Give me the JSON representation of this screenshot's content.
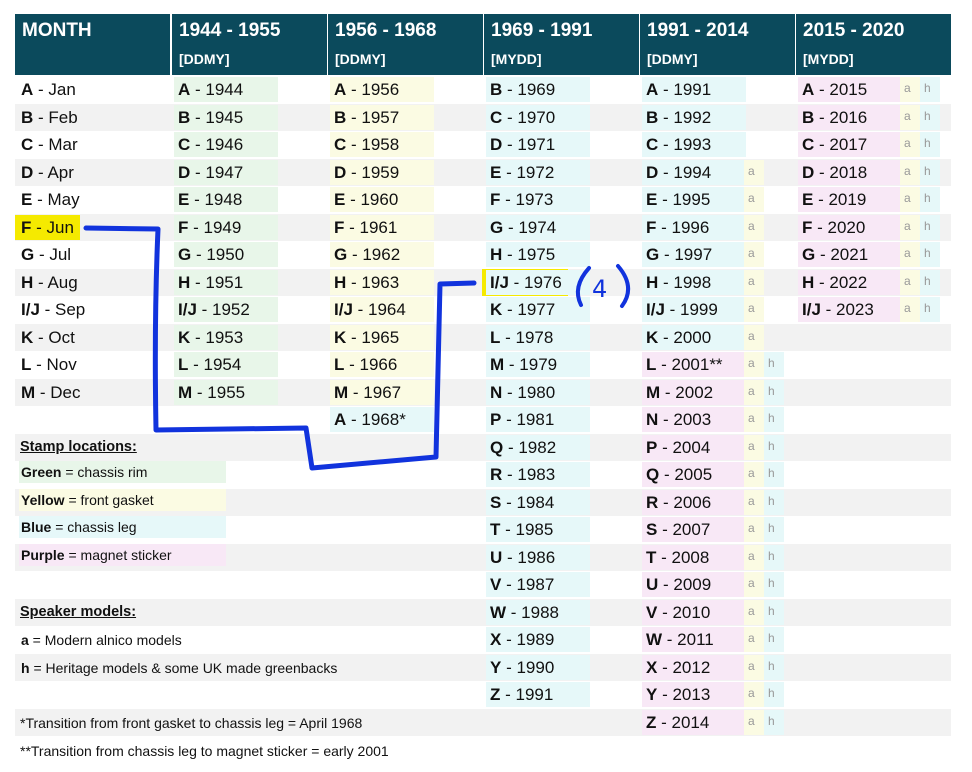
{
  "columns": [
    {
      "title": "MONTH",
      "sub": ""
    },
    {
      "title": "1944 - 1955",
      "sub": "[DDMY]"
    },
    {
      "title": "1956 - 1968",
      "sub": "[DDMY]"
    },
    {
      "title": "1969 - 1991",
      "sub": "[MYDD]"
    },
    {
      "title": "1991 - 2014",
      "sub": "[DDMY]"
    },
    {
      "title": "2015 - 2020",
      "sub": "[MYDD]"
    }
  ],
  "months": [
    {
      "code": "A",
      "name": " - Jan"
    },
    {
      "code": "B",
      "name": " - Feb"
    },
    {
      "code": "C",
      "name": " - Mar"
    },
    {
      "code": "D",
      "name": " - Apr"
    },
    {
      "code": "E",
      "name": " - May"
    },
    {
      "code": "F",
      "name": " - Jun"
    },
    {
      "code": "G",
      "name": " - Jul"
    },
    {
      "code": "H",
      "name": " - Aug"
    },
    {
      "code": "I/J",
      "name": " - Sep"
    },
    {
      "code": "K",
      "name": " - Oct"
    },
    {
      "code": "L",
      "name": " - Nov"
    },
    {
      "code": "M",
      "name": " - Dec"
    }
  ],
  "col1": [
    {
      "code": "A",
      "year": " - 1944"
    },
    {
      "code": "B",
      "year": " - 1945"
    },
    {
      "code": "C",
      "year": " - 1946"
    },
    {
      "code": "D",
      "year": " - 1947"
    },
    {
      "code": "E",
      "year": " - 1948"
    },
    {
      "code": "F",
      "year": " - 1949"
    },
    {
      "code": "G",
      "year": " - 1950"
    },
    {
      "code": "H",
      "year": " - 1951"
    },
    {
      "code": "I/J",
      "year": " - 1952"
    },
    {
      "code": "K",
      "year": " - 1953"
    },
    {
      "code": "L",
      "year": " - 1954"
    },
    {
      "code": "M",
      "year": " - 1955"
    }
  ],
  "col2": [
    {
      "code": "A",
      "year": " - 1956"
    },
    {
      "code": "B",
      "year": " - 1957"
    },
    {
      "code": "C",
      "year": " - 1958"
    },
    {
      "code": "D",
      "year": " - 1959"
    },
    {
      "code": "E",
      "year": " - 1960"
    },
    {
      "code": "F",
      "year": " - 1961"
    },
    {
      "code": "G",
      "year": " - 1962"
    },
    {
      "code": "H",
      "year": " - 1963"
    },
    {
      "code": "I/J",
      "year": " - 1964"
    },
    {
      "code": "K",
      "year": " - 1965"
    },
    {
      "code": "L",
      "year": " - 1966"
    },
    {
      "code": "M",
      "year": " - 1967"
    },
    {
      "code": "A",
      "year": " - 1968*"
    }
  ],
  "col3": [
    {
      "code": "B",
      "year": " - 1969"
    },
    {
      "code": "C",
      "year": " - 1970"
    },
    {
      "code": "D",
      "year": " - 1971"
    },
    {
      "code": "E",
      "year": " - 1972"
    },
    {
      "code": "F",
      "year": " - 1973"
    },
    {
      "code": "G",
      "year": " - 1974"
    },
    {
      "code": "H",
      "year": " - 1975"
    },
    {
      "code": "I/J",
      "year": " - 1976"
    },
    {
      "code": "K",
      "year": " - 1977"
    },
    {
      "code": "L",
      "year": " - 1978"
    },
    {
      "code": "M",
      "year": " - 1979"
    },
    {
      "code": "N",
      "year": " - 1980"
    },
    {
      "code": "P",
      "year": " - 1981"
    },
    {
      "code": "Q",
      "year": " - 1982"
    },
    {
      "code": "R",
      "year": " - 1983"
    },
    {
      "code": "S",
      "year": " - 1984"
    },
    {
      "code": "T",
      "year": " - 1985"
    },
    {
      "code": "U",
      "year": " - 1986"
    },
    {
      "code": "V",
      "year": " - 1987"
    },
    {
      "code": "W",
      "year": " - 1988"
    },
    {
      "code": "X",
      "year": " - 1989"
    },
    {
      "code": "Y",
      "year": " - 1990"
    },
    {
      "code": "Z",
      "year": " - 1991"
    }
  ],
  "col4": [
    {
      "code": "A",
      "year": " - 1991"
    },
    {
      "code": "B",
      "year": " - 1992"
    },
    {
      "code": "C",
      "year": " - 1993"
    },
    {
      "code": "D",
      "year": " - 1994",
      "tags": [
        "a"
      ]
    },
    {
      "code": "E",
      "year": " - 1995",
      "tags": [
        "a"
      ]
    },
    {
      "code": "F",
      "year": " - 1996",
      "tags": [
        "a"
      ]
    },
    {
      "code": "G",
      "year": " - 1997",
      "tags": [
        "a"
      ]
    },
    {
      "code": "H",
      "year": " - 1998",
      "tags": [
        "a"
      ]
    },
    {
      "code": "I/J",
      "year": " - 1999",
      "tags": [
        "a"
      ]
    },
    {
      "code": "K",
      "year": " - 2000",
      "tags": [
        "a"
      ]
    },
    {
      "code": "L",
      "year": " - 2001**",
      "tags": [
        "a",
        "h"
      ]
    },
    {
      "code": "M",
      "year": " - 2002",
      "tags": [
        "a",
        "h"
      ]
    },
    {
      "code": "N",
      "year": " - 2003",
      "tags": [
        "a",
        "h"
      ]
    },
    {
      "code": "P",
      "year": " - 2004",
      "tags": [
        "a",
        "h"
      ]
    },
    {
      "code": "Q",
      "year": " - 2005",
      "tags": [
        "a",
        "h"
      ]
    },
    {
      "code": "R",
      "year": " - 2006",
      "tags": [
        "a",
        "h"
      ]
    },
    {
      "code": "S",
      "year": " - 2007",
      "tags": [
        "a",
        "h"
      ]
    },
    {
      "code": "T",
      "year": " - 2008",
      "tags": [
        "a",
        "h"
      ]
    },
    {
      "code": "U",
      "year": " - 2009",
      "tags": [
        "a",
        "h"
      ]
    },
    {
      "code": "V",
      "year": " - 2010",
      "tags": [
        "a",
        "h"
      ]
    },
    {
      "code": "W",
      "year": " - 2011",
      "tags": [
        "a",
        "h"
      ]
    },
    {
      "code": "X",
      "year": " - 2012",
      "tags": [
        "a",
        "h"
      ]
    },
    {
      "code": "Y",
      "year": " - 2013",
      "tags": [
        "a",
        "h"
      ]
    },
    {
      "code": "Z",
      "year": " - 2014",
      "tags": [
        "a",
        "h"
      ]
    }
  ],
  "col5": [
    {
      "code": "A",
      "year": " - 2015",
      "tags": [
        "a",
        "h"
      ]
    },
    {
      "code": "B",
      "year": " - 2016",
      "tags": [
        "a",
        "h"
      ]
    },
    {
      "code": "C",
      "year": " - 2017",
      "tags": [
        "a",
        "h"
      ]
    },
    {
      "code": "D",
      "year": " - 2018",
      "tags": [
        "a",
        "h"
      ]
    },
    {
      "code": "E",
      "year": " - 2019",
      "tags": [
        "a",
        "h"
      ]
    },
    {
      "code": "F",
      "year": " - 2020",
      "tags": [
        "a",
        "h"
      ]
    },
    {
      "code": "G",
      "year": " - 2021",
      "tags": [
        "a",
        "h"
      ]
    },
    {
      "code": "H",
      "year": " - 2022",
      "tags": [
        "a",
        "h"
      ]
    },
    {
      "code": "I/J",
      "year": " - 2023",
      "tags": [
        "a",
        "h"
      ]
    }
  ],
  "legend": {
    "stamp_heading": "Stamp locations:",
    "stamps": [
      {
        "bold": "Green",
        "text": " = chassis rim",
        "color": "#e8f6e9"
      },
      {
        "bold": "Yellow",
        "text": " = front gasket",
        "color": "#fbfbe3"
      },
      {
        "bold": "Blue",
        "text": " = chassis leg",
        "color": "#e6f8f9"
      },
      {
        "bold": "Purple",
        "text": " = magnet sticker",
        "color": "#f8e8f6"
      }
    ],
    "speaker_heading": "Speaker models:",
    "speakers": [
      {
        "bold": "a",
        "text": " = Modern alnico models"
      },
      {
        "bold": "h",
        "text": " = Heritage models & some UK made greenbacks"
      }
    ]
  },
  "notes": [
    "*Transition from front gasket to chassis leg = April 1968",
    "**Transition from chassis leg to magnet sticker = early 2001"
  ],
  "annotation": {
    "label": "(4)",
    "highlight_color": "#f5ea00",
    "ink_color": "#1133dd"
  },
  "colors": {
    "header": "#0b4a5c",
    "green": "#e8f6e9",
    "yellow": "#fbfbe3",
    "blue": "#e6f8f9",
    "purple": "#f8e8f6",
    "stripe": "#f2f2f2"
  }
}
